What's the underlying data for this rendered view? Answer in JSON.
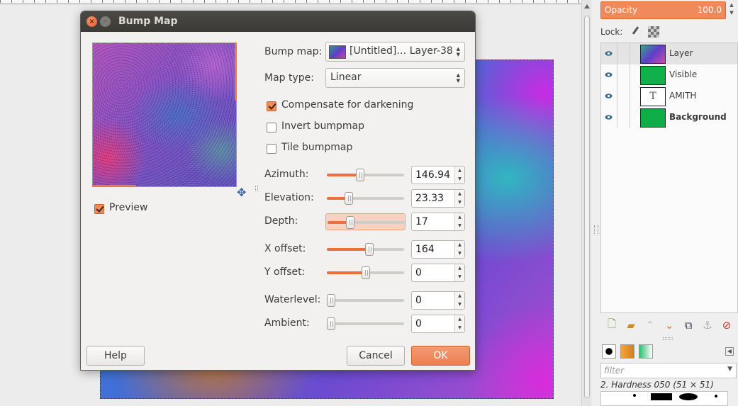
{
  "dialog": {
    "title": "Bump Map",
    "close_glyph": "×",
    "min_glyph": "–",
    "preview": {
      "label": "Preview",
      "checked": true
    },
    "fields": {
      "bump_map_label": "Bump map:",
      "bump_map_value": "[Untitled]… Layer-38",
      "map_type_label": "Map type:",
      "map_type_value": "Linear"
    },
    "options": [
      {
        "label": "Compensate for darkening",
        "checked": true
      },
      {
        "label": "Invert bumpmap",
        "checked": false
      },
      {
        "label": "Tile bumpmap",
        "checked": false
      }
    ],
    "sliders": [
      {
        "label": "Azimuth:",
        "value": "146.94",
        "fraction": 0.42
      },
      {
        "label": "Elevation:",
        "value": "23.33",
        "fraction": 0.26
      },
      {
        "label": "Depth:",
        "value": "17",
        "fraction": 0.27,
        "active": true
      },
      {
        "label": "X offset:",
        "value": "164",
        "fraction": 0.56
      },
      {
        "label": "Y offset:",
        "value": "0",
        "fraction": 0.5
      },
      {
        "label": "Waterlevel:",
        "value": "0",
        "fraction": 0.0
      },
      {
        "label": "Ambient:",
        "value": "0",
        "fraction": 0.0
      }
    ],
    "buttons": {
      "help": "Help",
      "cancel": "Cancel",
      "ok": "OK"
    },
    "nav_icon": "move-cross-icon"
  },
  "layers_panel": {
    "opacity_label": "Opacity",
    "opacity_value": "100.0",
    "lock_label": "Lock:",
    "layers": [
      {
        "name": "Layer",
        "selected": true,
        "bold": false,
        "thumb": "texture"
      },
      {
        "name": "Visible",
        "selected": false,
        "bold": false,
        "thumb": "green-text"
      },
      {
        "name": "AMITH",
        "selected": false,
        "bold": false,
        "thumb": "text"
      },
      {
        "name": "Background",
        "selected": false,
        "bold": true,
        "thumb": "green"
      }
    ],
    "accent": "#f08a5a"
  },
  "brushes_panel": {
    "filter_placeholder": "filter",
    "brush_title": "2. Hardness 050 (51 × 51)"
  }
}
